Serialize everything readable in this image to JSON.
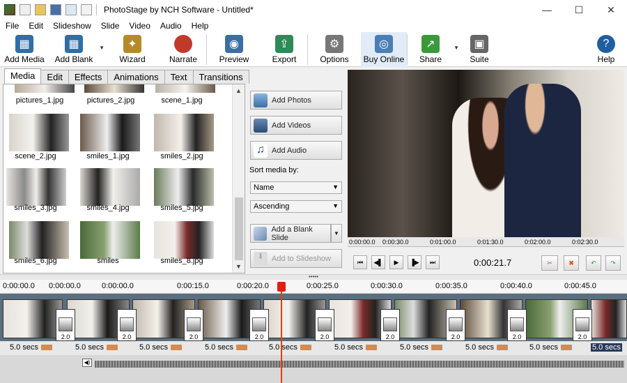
{
  "window": {
    "title": "PhotoStage by NCH Software - Untitled*",
    "controls": [
      "—",
      "☐",
      "✕"
    ]
  },
  "menu": [
    "File",
    "Edit",
    "Slideshow",
    "Slide",
    "Video",
    "Audio",
    "Help"
  ],
  "toolbar": [
    {
      "id": "add-media",
      "label": "Add Media",
      "color": "#2f6fa8"
    },
    {
      "id": "add-blank",
      "label": "Add Blank",
      "color": "#2f6fa8"
    },
    {
      "id": "wizard",
      "label": "Wizard",
      "color": "#b58b2a"
    },
    {
      "id": "narrate",
      "label": "Narrate",
      "color": "#c0392b"
    },
    {
      "id": "preview",
      "label": "Preview",
      "color": "#3a6ea5"
    },
    {
      "id": "export",
      "label": "Export",
      "color": "#2e8b57"
    },
    {
      "id": "options",
      "label": "Options",
      "color": "#777"
    },
    {
      "id": "buy-online",
      "label": "Buy Online",
      "color": "#4a7fb5"
    },
    {
      "id": "share",
      "label": "Share",
      "color": "#3a9a3a"
    },
    {
      "id": "suite",
      "label": "Suite",
      "color": "#666"
    },
    {
      "id": "help",
      "label": "Help",
      "color": "#1f5fa0"
    }
  ],
  "tabs": [
    "Media",
    "Edit",
    "Effects",
    "Animations",
    "Text",
    "Transitions"
  ],
  "media": [
    "pictures_1.jpg",
    "pictures_2.jpg",
    "scene_1.jpg",
    "scene_2.jpg",
    "smiles_1.jpg",
    "smiles_2.jpg",
    "smiles_3.jpg",
    "smiles_4.jpg",
    "smiles_5.jpg",
    "smiles_6.jpg",
    "smiles",
    "smiles_8.jpg"
  ],
  "side": {
    "add_photos": "Add Photos",
    "add_videos": "Add Videos",
    "add_audio": "Add Audio",
    "sort_label": "Sort media by:",
    "sort_value": "Name",
    "order_value": "Ascending",
    "add_blank_slide": "Add a Blank Slide",
    "add_to_slideshow": "Add to Slideshow"
  },
  "preview_ruler": [
    "0:00:00.0",
    "0:00:30.0",
    "0:01:00.0",
    "0:01:30.0",
    "0:02:00.0",
    "0:02:30.0"
  ],
  "preview_time": "0:00:21.7",
  "timeline_ruler": [
    "0:00:00.0",
    "0:00:00.0",
    "0:00:00.0",
    "0:00:15.0",
    "0:00:20.0",
    "0:00:25.0",
    "0:00:30.0",
    "0:00:35.0",
    "0:00:40.0",
    "0:00:45.0"
  ],
  "transition_value": "2.0",
  "clip_duration": "5.0 secs"
}
